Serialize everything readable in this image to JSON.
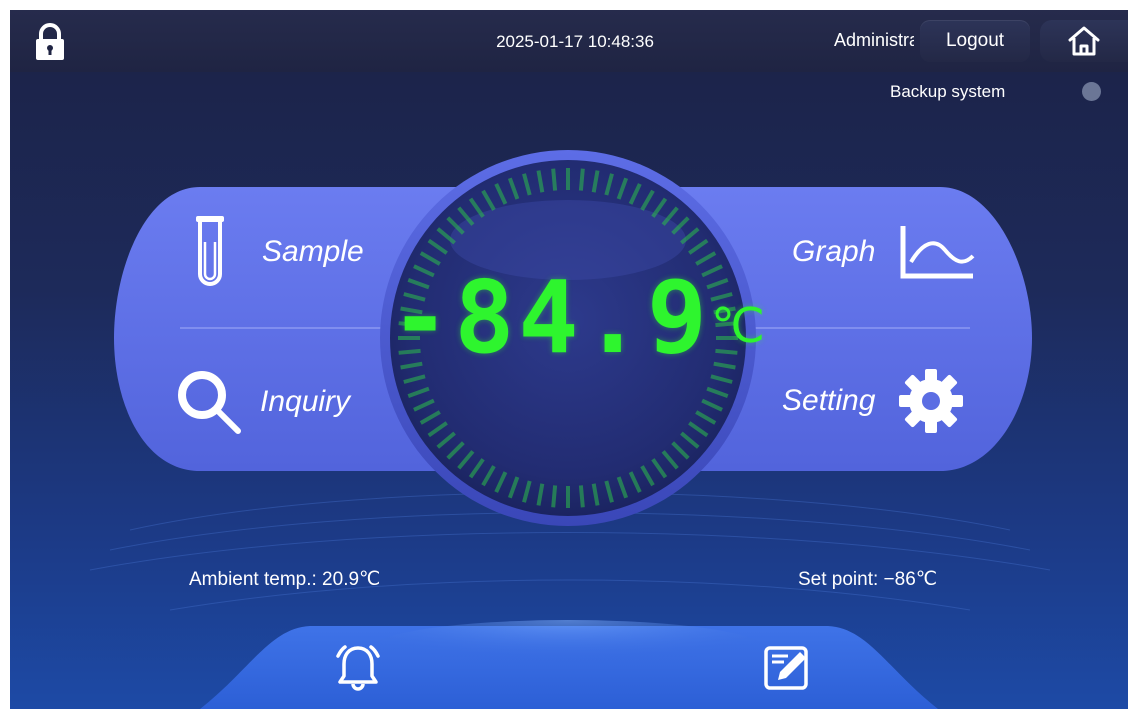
{
  "header": {
    "datetime": "2025-01-17 10:48:36",
    "user": "Administrator",
    "logout_label": "Logout"
  },
  "backup": {
    "label": "Backup system",
    "status_color": "#6b7696"
  },
  "display": {
    "temperature": "-84.9",
    "unit": "℃",
    "digit_color": "#2ef52e"
  },
  "menu": {
    "sample_label": "Sample",
    "inquiry_label": "Inquiry",
    "graph_label": "Graph",
    "setting_label": "Setting"
  },
  "footer": {
    "ambient_temp": "Ambient temp.: 20.9℃",
    "set_point": "Set point: −86℃"
  },
  "icons": [
    "lock-icon",
    "home-icon",
    "test-tube-icon",
    "magnifier-icon",
    "graph-icon",
    "gear-icon",
    "alarm-bell-icon",
    "edit-note-icon"
  ],
  "colors": {
    "accent_panel": "#5b6de3",
    "background_top": "#1c2246",
    "background_bottom": "#1d4aa6"
  }
}
